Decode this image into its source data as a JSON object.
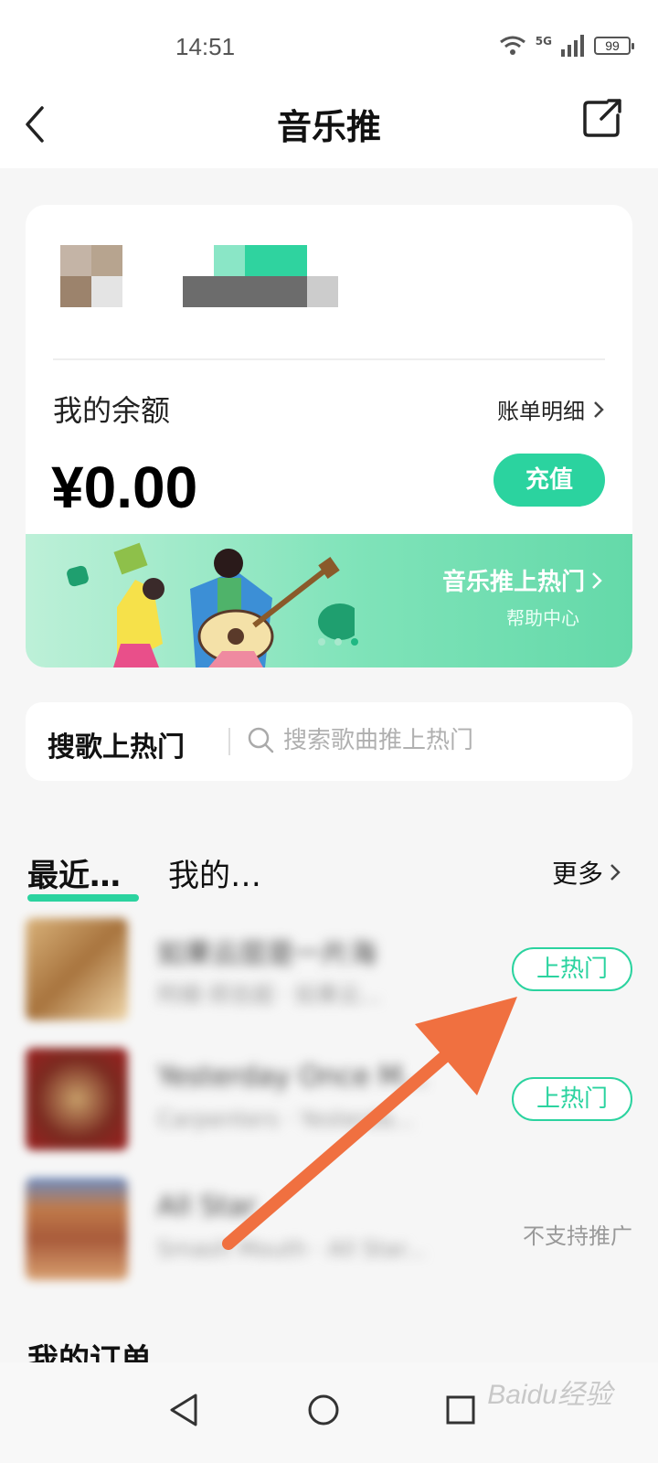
{
  "status_bar": {
    "time": "14:51",
    "network": "5G",
    "battery": "99"
  },
  "header": {
    "title": "音乐推"
  },
  "balance": {
    "label": "我的余额",
    "bill_link": "账单明细",
    "amount": "¥0.00",
    "recharge_label": "充值"
  },
  "banner": {
    "title": "音乐推上热门",
    "subtitle": "帮助中心"
  },
  "search": {
    "title": "搜歌上热门",
    "placeholder": "搜索歌曲推上热门"
  },
  "tabs": [
    {
      "label": "最近…",
      "active": true
    },
    {
      "label": "我的…",
      "active": false
    }
  ],
  "more_label": "更多",
  "songs": [
    {
      "title": "如果云层是一片海",
      "artist": "阿细·郑吉超 · 如果云...",
      "action": "上热门"
    },
    {
      "title": "Yesterday Once M...",
      "artist": "Carpenters · Yesterda...",
      "action": "上热门"
    },
    {
      "title": "All Star",
      "artist": "Smash Mouth · All Star...",
      "action": "不支持推广"
    }
  ],
  "orders_title": "我的订单",
  "watermark": "Baidu经验",
  "colors": {
    "accent": "#2bd39f",
    "annotation_arrow": "#f07040"
  }
}
